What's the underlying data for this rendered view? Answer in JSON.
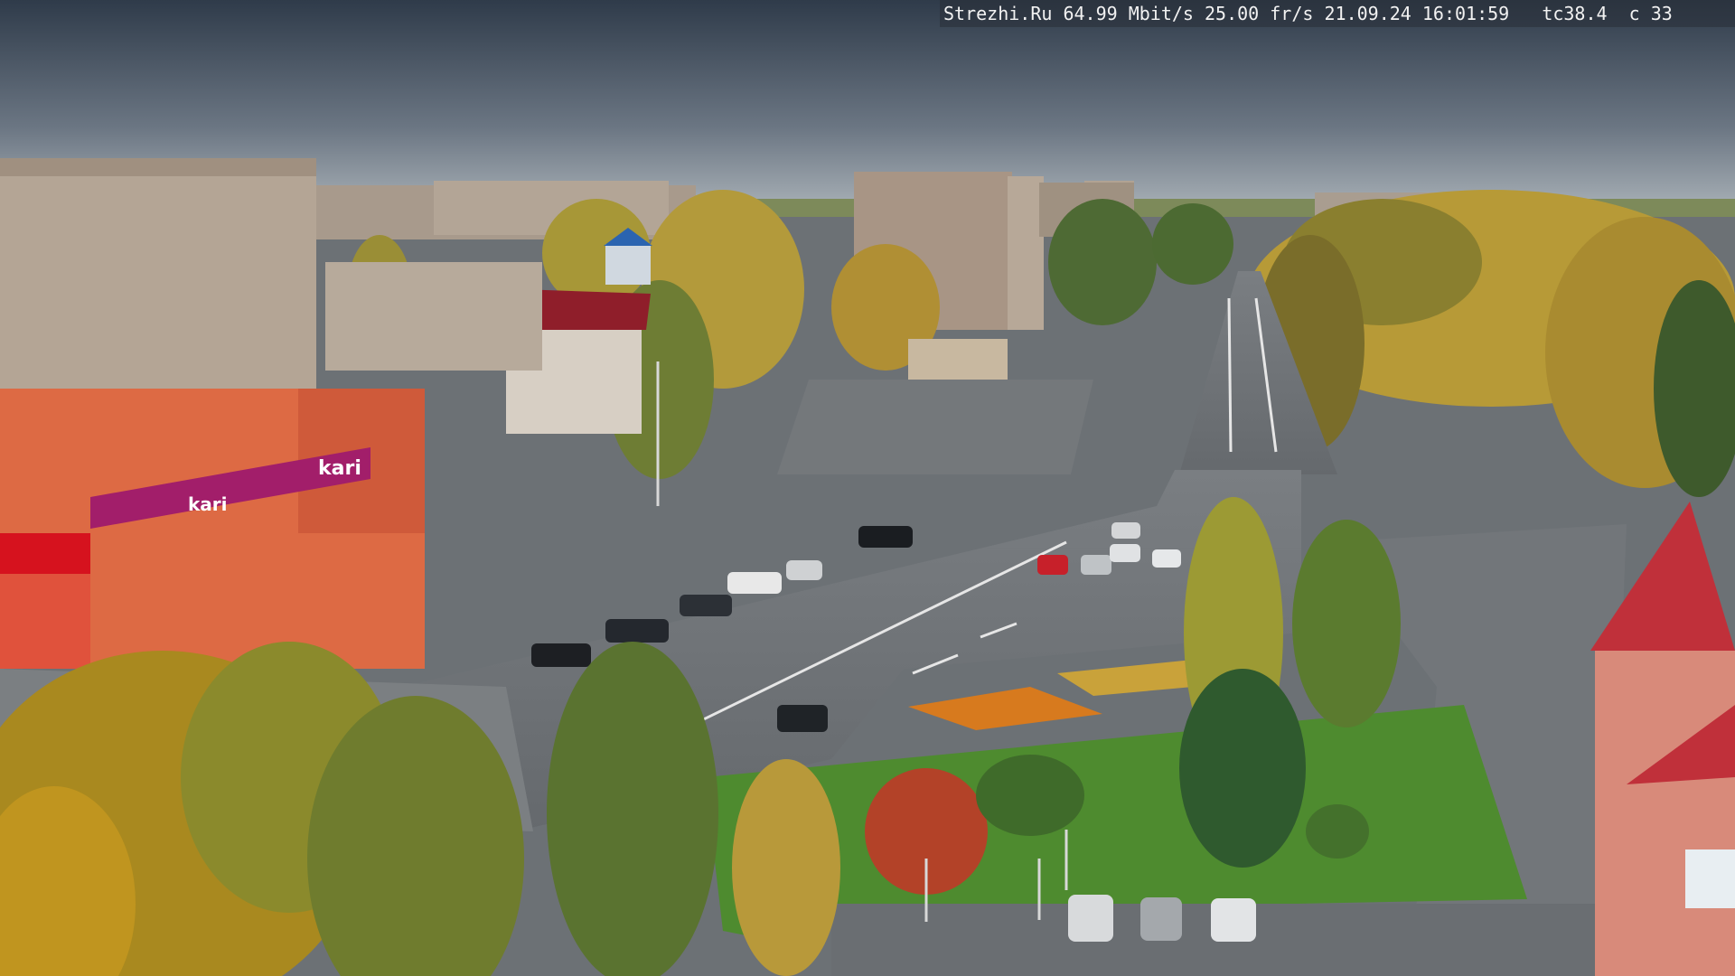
{
  "overlay": {
    "site": "Strezhi.Ru",
    "bitrate": "64.99 Mbit/s",
    "framerate": "25.00 fr/s",
    "date": "21.09.24",
    "time": "16:01:59",
    "tc": "tc38.4",
    "c": "c 33"
  },
  "signs": {
    "store_logo": "kari",
    "store_banner": "kari"
  },
  "colors": {
    "sky_top": "#2f3b4a",
    "sky_bottom": "#9aa4ad",
    "asphalt": "#6f7478",
    "grass": "#4f8a2e",
    "foliage_yellow": "#c9a43a",
    "foliage_green": "#5c7a34",
    "building_beige": "#b5a898",
    "store_red": "#e25a3c",
    "banner_magenta": "#a21e6a",
    "tower_red": "#c0303a"
  }
}
